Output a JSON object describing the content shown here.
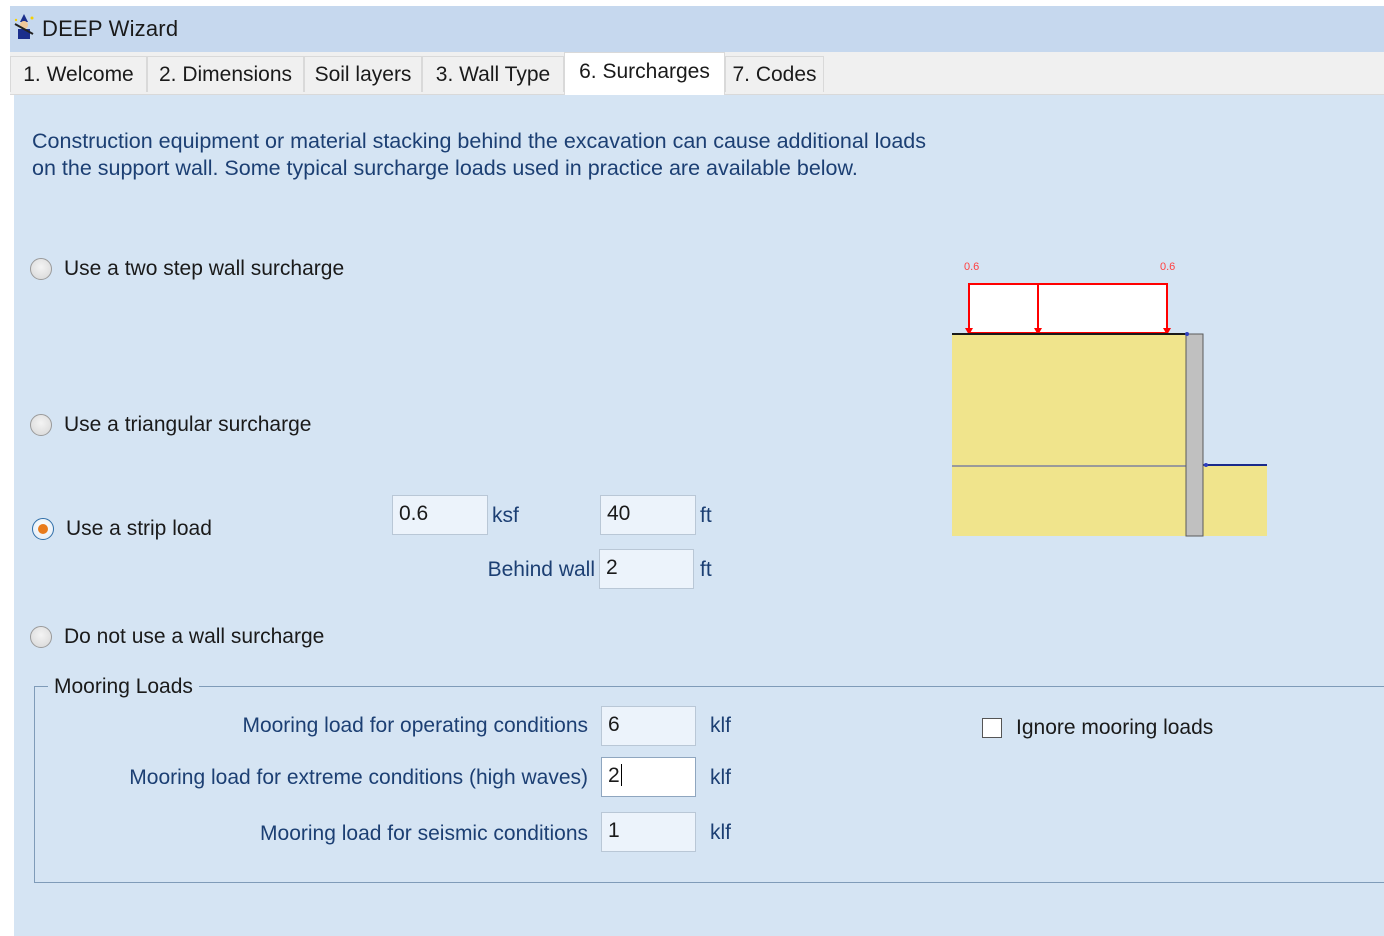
{
  "window": {
    "title": "DEEP Wizard",
    "icon": "wizard-icon"
  },
  "tabs": [
    {
      "label": "1. Welcome",
      "active": false
    },
    {
      "label": "2. Dimensions",
      "active": false
    },
    {
      "label": "Soil layers",
      "active": false
    },
    {
      "label": "3. Wall Type",
      "active": false
    },
    {
      "label": "6. Surcharges",
      "active": true
    },
    {
      "label": "7. Codes",
      "active": false
    }
  ],
  "intro_text": "Construction equipment or material stacking behind the excavation can cause additional loads on the support wall. Some typical surcharge loads used in practice are available below.",
  "surcharge_options": {
    "two_step": {
      "label": "Use a two step wall surcharge",
      "selected": false
    },
    "triangular": {
      "label": "Use a triangular surcharge",
      "selected": false
    },
    "strip": {
      "label": "Use a strip load",
      "selected": true
    },
    "none": {
      "label": "Do not use a wall surcharge",
      "selected": false
    }
  },
  "strip_load": {
    "magnitude": "0.6",
    "magnitude_unit": "ksf",
    "width": "40",
    "width_unit": "ft",
    "behind_wall_label": "Behind wall",
    "behind_wall": "2",
    "behind_wall_unit": "ft"
  },
  "diagram": {
    "left_load_label": "0.6",
    "right_load_label": "0.6",
    "load_color": "#ff0000",
    "soil_color": "#f0e48c",
    "wall_color": "#c0c0c0"
  },
  "mooring": {
    "group_title": "Mooring Loads",
    "operating_label": "Mooring load for operating conditions",
    "operating_value": "6",
    "extreme_label": "Mooring load for extreme conditions (high waves)",
    "extreme_value": "2",
    "seismic_label": "Mooring load for seismic conditions",
    "seismic_value": "1",
    "unit": "klf",
    "ignore_label": "Ignore mooring loads",
    "ignore_checked": false
  },
  "colors": {
    "panel_bg": "#d5e4f3",
    "title_bg": "#c6d8ee",
    "label_text": "#1c3f73",
    "radio_selected": "#e87b1c"
  }
}
